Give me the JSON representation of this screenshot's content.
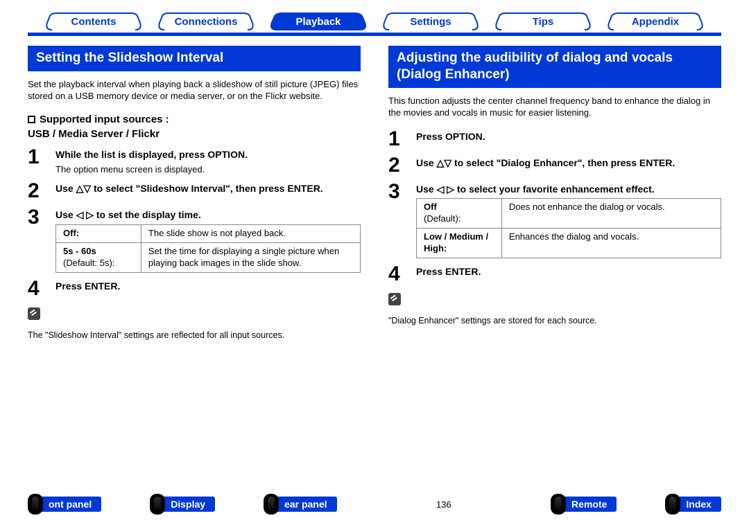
{
  "topNav": {
    "contents": "Contents",
    "connections": "Connections",
    "playback": "Playback",
    "settings": "Settings",
    "tips": "Tips",
    "appendix": "Appendix"
  },
  "left": {
    "title": "Setting the Slideshow Interval",
    "intro": "Set the playback interval when playing back a slideshow of still picture (JPEG) files stored on a USB memory device or media server, or on the Flickr website.",
    "supportedLabel": "Supported input sources :",
    "supportedLine2": "USB / Media Server / Flickr",
    "steps": {
      "s1title": "While the list is displayed, press OPTION.",
      "s1body": "The option menu screen is displayed.",
      "s2title": "Use △▽ to select \"Slideshow Interval\", then press ENTER.",
      "s3title": "Use ◁ ▷ to set the display time.",
      "s4title": "Press ENTER."
    },
    "tbl": {
      "r1c1": "Off:",
      "r1c2": "The slide show is not played back.",
      "r2c1a": "5s - 60s",
      "r2c1b": "(Default: 5s):",
      "r2c2": "Set the time for displaying a single picture when playing back images in the slide show."
    },
    "note": "The \"Slideshow Interval\" settings are reflected for all input sources."
  },
  "right": {
    "title": "Adjusting the audibility of dialog and vocals (Dialog Enhancer)",
    "intro": "This function adjusts the center channel frequency band to enhance the dialog in the movies and vocals in music for easier listening.",
    "steps": {
      "s1title": "Press OPTION.",
      "s2title": "Use △▽ to select \"Dialog Enhancer\", then press ENTER.",
      "s3title": "Use ◁ ▷ to select your favorite enhancement effect.",
      "s4title": "Press ENTER."
    },
    "tbl": {
      "r1c1a": "Off",
      "r1c1b": "(Default):",
      "r1c2": "Does not enhance the dialog or vocals.",
      "r2c1": "Low / Medium / High:",
      "r2c2": "Enhances the dialog and vocals."
    },
    "note": "\"Dialog Enhancer\" settings are stored for each source."
  },
  "bottomNav": {
    "frontPanel": "ont panel",
    "display": "Display",
    "rearPanel": "ear panel",
    "pageNum": "136",
    "remote": "Remote",
    "index": "Index"
  }
}
